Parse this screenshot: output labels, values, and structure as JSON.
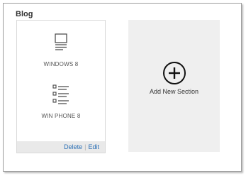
{
  "page": {
    "section_title": "Blog"
  },
  "blog_card": {
    "tiles": [
      {
        "label": "WINDOWS 8",
        "icon": "document-icon"
      },
      {
        "label": "WIN PHONE 8",
        "icon": "list-icon"
      }
    ],
    "actions": {
      "delete_label": "Delete",
      "edit_label": "Edit"
    }
  },
  "add_section": {
    "label": "Add New Section",
    "icon": "plus-circle-icon"
  },
  "colors": {
    "link": "#2a6fb5",
    "card_footer": "#e9e9e9",
    "add_panel": "#efefef",
    "icon_stroke": "#444444"
  }
}
